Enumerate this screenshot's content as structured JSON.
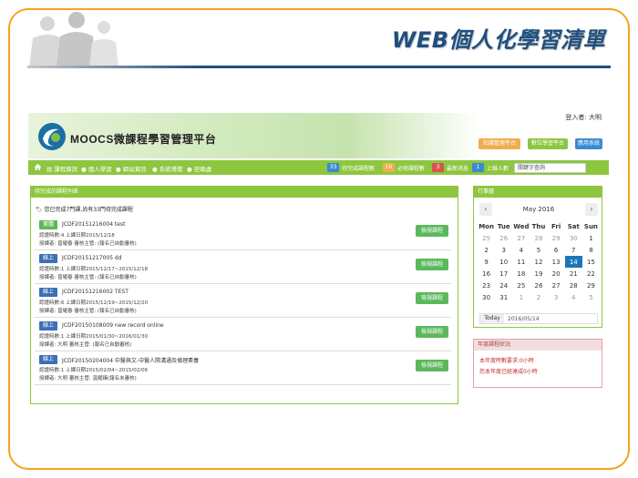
{
  "slide": {
    "title": "WEB個人化學習清單"
  },
  "colors": {
    "frame": "#f0a818",
    "title": "#1f4f7f",
    "nav_green": "#8dc63f",
    "view_button": "#5cb85c",
    "badge_green": "#5cb85c",
    "badge_blue": "#3c6fb5",
    "calendar_today": "#1d76b8"
  },
  "header": {
    "brand": "MOOCS微課程學習管理平台",
    "user_label": "登入者: 大明",
    "buttons": [
      {
        "label": "知識管理平台",
        "color": "#f0ad4e"
      },
      {
        "label": "數位學習平台",
        "color": "#8dc63f"
      },
      {
        "label": "應用系統",
        "color": "#3a8bd0"
      }
    ]
  },
  "nav": {
    "items": [
      "課程資訊",
      "個人學習",
      "網站資訊",
      "系統導覽",
      "密碼處"
    ],
    "stats": [
      {
        "count": "33",
        "label": "待完成課程數",
        "color": "#3a8bd0"
      },
      {
        "count": "16",
        "label": "必修課程數",
        "color": "#f0ad4e"
      },
      {
        "count": "3",
        "label": "最新消息",
        "color": "#d9534f"
      },
      {
        "count": "1",
        "label": "上線人數",
        "color": "#3a8bd0"
      }
    ],
    "search_placeholder": "關鍵字查詢"
  },
  "course_panel": {
    "title": "待完成的課程列表",
    "notice": "您已完成7門課,尚有33門待完成課程",
    "view_label": "檢視課程",
    "courses": [
      {
        "badge": "實體",
        "badge_color": "#5cb85c",
        "title": "JCDF20151216004 test",
        "line1": "認證時數:4  上課日期2015/12/18",
        "line2": "授課者: 曾耀春    審核主管: (報名已自動審核)"
      },
      {
        "badge": "線上",
        "badge_color": "#3c6fb5",
        "title": "JCDF20151217005 dd",
        "line1": "認證時數:1  上課日期2015/12/17~2015/12/18",
        "line2": "授課者: 曾耀春    審核主管: (報名已自動審核)"
      },
      {
        "badge": "線上",
        "badge_color": "#3c6fb5",
        "title": "JCDF20151216002 TEST",
        "line1": "認證時數:6  上課日期2015/12/19~2015/12/20",
        "line2": "授課者: 曾耀春    審核主管: (報名已自動審核)"
      },
      {
        "badge": "線上",
        "badge_color": "#3c6fb5",
        "title": "JCDF20150108009 new record online",
        "line1": "認證時數:1  上課日期2015/01/30~2016/01/30",
        "line2": "授課者: 大明    審核主管: (報名已自動審核)"
      },
      {
        "badge": "線上",
        "badge_color": "#3c6fb5",
        "title": "JCDF20150204004 中醫與文-中醫人際溝通及倫理素養",
        "line1": "認證時數:1  上課日期2015/02/04~2015/02/06",
        "line2": "授課者: 大明    審核主管: 溫耀臻(報名未審核)"
      }
    ]
  },
  "calendar": {
    "title": "行事曆",
    "month": "May 2016",
    "prev": "‹",
    "next": "›",
    "weekdays": [
      "Mon",
      "Tue",
      "Wed",
      "Thu",
      "Fri",
      "Sat",
      "Sun"
    ],
    "weeks": [
      [
        "25",
        "26",
        "27",
        "28",
        "29",
        "30",
        "1"
      ],
      [
        "2",
        "3",
        "4",
        "5",
        "6",
        "7",
        "8"
      ],
      [
        "9",
        "10",
        "11",
        "12",
        "13",
        "14",
        "15"
      ],
      [
        "16",
        "17",
        "18",
        "19",
        "20",
        "21",
        "22"
      ],
      [
        "23",
        "24",
        "25",
        "26",
        "27",
        "28",
        "29"
      ],
      [
        "30",
        "31",
        "1",
        "2",
        "3",
        "4",
        "5"
      ]
    ],
    "today_label": "Today",
    "today_value": "2016/05/14"
  },
  "status_panel": {
    "title": "年度課程狀況",
    "lines": [
      "本年度時數要求:0小時",
      "您本年度已經達成0小時"
    ]
  }
}
